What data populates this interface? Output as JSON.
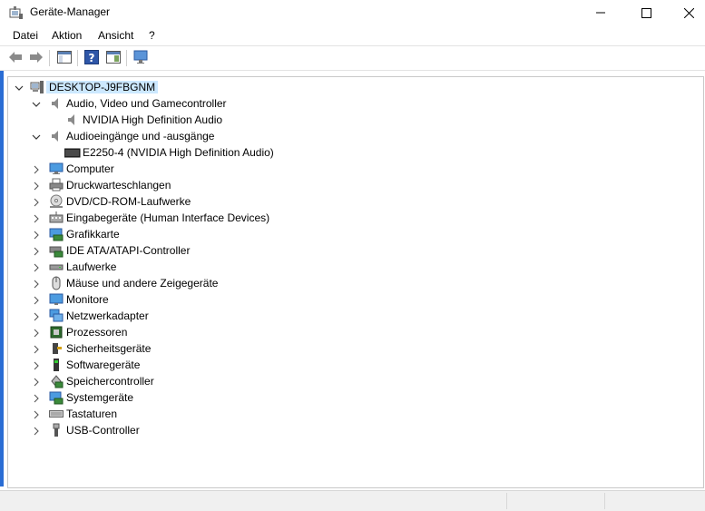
{
  "window": {
    "title": "Geräte-Manager"
  },
  "menu": [
    "Datei",
    "Aktion",
    "Ansicht",
    "?"
  ],
  "tree": {
    "root": "DESKTOP-J9FBGNM",
    "groups": [
      {
        "label": "Audio, Video und Gamecontroller",
        "icon": "speaker-icon",
        "expanded": true,
        "children": [
          "NVIDIA High Definition Audio"
        ]
      },
      {
        "label": "Audioeingänge und -ausgänge",
        "icon": "speaker-icon",
        "expanded": true,
        "children": [
          "E2250-4 (NVIDIA High Definition Audio)"
        ]
      },
      {
        "label": "Computer",
        "icon": "computer-icon"
      },
      {
        "label": "Druckwarteschlangen",
        "icon": "printer-icon"
      },
      {
        "label": "DVD/CD-ROM-Laufwerke",
        "icon": "disc-icon"
      },
      {
        "label": "Eingabegeräte (Human Interface Devices)",
        "icon": "hid-icon"
      },
      {
        "label": "Grafikkarte",
        "icon": "display-adapter-icon"
      },
      {
        "label": "IDE ATA/ATAPI-Controller",
        "icon": "ide-controller-icon"
      },
      {
        "label": "Laufwerke",
        "icon": "drive-icon"
      },
      {
        "label": "Mäuse und andere Zeigegeräte",
        "icon": "mouse-icon"
      },
      {
        "label": "Monitore",
        "icon": "monitor-icon"
      },
      {
        "label": "Netzwerkadapter",
        "icon": "network-icon"
      },
      {
        "label": "Prozessoren",
        "icon": "processor-icon"
      },
      {
        "label": "Sicherheitsgeräte",
        "icon": "security-icon"
      },
      {
        "label": "Softwaregeräte",
        "icon": "software-device-icon"
      },
      {
        "label": "Speichercontroller",
        "icon": "storage-controller-icon"
      },
      {
        "label": "Systemgeräte",
        "icon": "system-device-icon"
      },
      {
        "label": "Tastaturen",
        "icon": "keyboard-icon"
      },
      {
        "label": "USB-Controller",
        "icon": "usb-icon"
      }
    ]
  },
  "colors": {
    "accent": "#2a6dd4",
    "selection": "#cce8ff"
  }
}
